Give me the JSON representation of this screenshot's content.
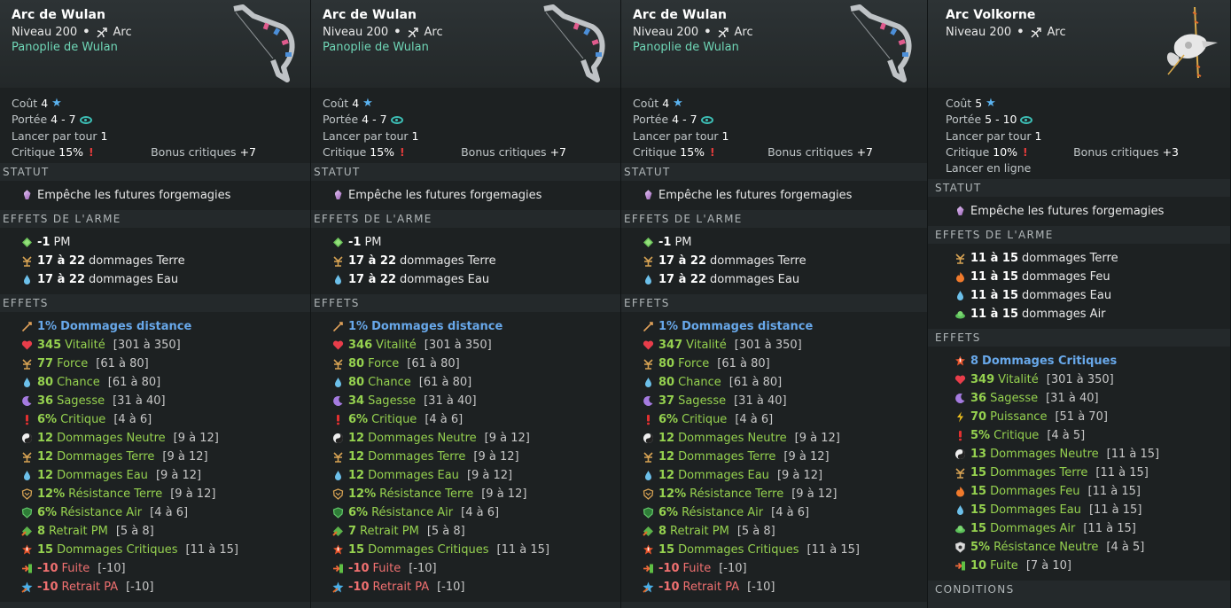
{
  "cards": [
    {
      "name": "Arc de Wulan",
      "level": "Niveau 200",
      "type": "Arc",
      "set": "Panoplie de Wulan",
      "cost_label": "Coût",
      "cost": "4",
      "range_label": "Portée",
      "range": "4 - 7",
      "casts_label": "Lancer par tour",
      "casts": "1",
      "crit_label": "Critique",
      "crit": "15%",
      "crit_bonus_label": "Bonus critiques",
      "crit_bonus": "+7",
      "extra": "",
      "statut_title": "STATUT",
      "statut": "Empêche les futures forgemagies",
      "weapon_effects_title": "EFFETS DE L'ARME",
      "weapon_effects": [
        {
          "icon": "pm-icon",
          "val": "-1",
          "text": "PM"
        },
        {
          "icon": "terre-icon",
          "val": "17 à 22",
          "text": "dommages Terre"
        },
        {
          "icon": "eau-icon",
          "val": "17 à 22",
          "text": "dommages Eau"
        }
      ],
      "effects_title": "EFFETS",
      "effects": [
        {
          "icon": "distance-icon",
          "val": "1%",
          "text": "Dommages distance",
          "range": "",
          "color": "b"
        },
        {
          "icon": "heart-icon",
          "val": "345",
          "text": "Vitalité",
          "range": "[301 à 350]",
          "color": "g"
        },
        {
          "icon": "terre-icon",
          "val": "77",
          "text": "Force",
          "range": "[61 à 80]",
          "color": "g"
        },
        {
          "icon": "eau-icon",
          "val": "80",
          "text": "Chance",
          "range": "[61 à 80]",
          "color": "g"
        },
        {
          "icon": "sagesse-icon",
          "val": "36",
          "text": "Sagesse",
          "range": "[31 à 40]",
          "color": "g"
        },
        {
          "icon": "crit-icon",
          "val": "6%",
          "text": "Critique",
          "range": "[4 à 6]",
          "color": "g"
        },
        {
          "icon": "neutre-icon",
          "val": "12",
          "text": "Dommages Neutre",
          "range": "[9 à 12]",
          "color": "g"
        },
        {
          "icon": "terre-icon",
          "val": "12",
          "text": "Dommages Terre",
          "range": "[9 à 12]",
          "color": "g"
        },
        {
          "icon": "eau-icon",
          "val": "12",
          "text": "Dommages Eau",
          "range": "[9 à 12]",
          "color": "g"
        },
        {
          "icon": "res-terre-icon",
          "val": "12%",
          "text": "Résistance Terre",
          "range": "[9 à 12]",
          "color": "g"
        },
        {
          "icon": "res-air-icon",
          "val": "6%",
          "text": "Résistance Air",
          "range": "[4 à 6]",
          "color": "g"
        },
        {
          "icon": "retrait-pm-icon",
          "val": "8",
          "text": "Retrait PM",
          "range": "[5 à 8]",
          "color": "g"
        },
        {
          "icon": "dommages-crit-icon",
          "val": "15",
          "text": "Dommages Critiques",
          "range": "[11 à 15]",
          "color": "g"
        },
        {
          "icon": "fuite-icon",
          "val": "-10",
          "text": "Fuite",
          "range": "[-10]",
          "color": "r"
        },
        {
          "icon": "retrait-pa-icon",
          "val": "-10",
          "text": "Retrait PA",
          "range": "[-10]",
          "color": "r"
        }
      ]
    },
    {
      "name": "Arc de Wulan",
      "level": "Niveau 200",
      "type": "Arc",
      "set": "Panoplie de Wulan",
      "cost_label": "Coût",
      "cost": "4",
      "range_label": "Portée",
      "range": "4 - 7",
      "casts_label": "Lancer par tour",
      "casts": "1",
      "crit_label": "Critique",
      "crit": "15%",
      "crit_bonus_label": "Bonus critiques",
      "crit_bonus": "+7",
      "extra": "",
      "statut_title": "STATUT",
      "statut": "Empêche les futures forgemagies",
      "weapon_effects_title": "EFFETS DE L'ARME",
      "weapon_effects": [
        {
          "icon": "pm-icon",
          "val": "-1",
          "text": "PM"
        },
        {
          "icon": "terre-icon",
          "val": "17 à 22",
          "text": "dommages Terre"
        },
        {
          "icon": "eau-icon",
          "val": "17 à 22",
          "text": "dommages Eau"
        }
      ],
      "effects_title": "EFFETS",
      "effects": [
        {
          "icon": "distance-icon",
          "val": "1%",
          "text": "Dommages distance",
          "range": "",
          "color": "b"
        },
        {
          "icon": "heart-icon",
          "val": "346",
          "text": "Vitalité",
          "range": "[301 à 350]",
          "color": "g"
        },
        {
          "icon": "terre-icon",
          "val": "80",
          "text": "Force",
          "range": "[61 à 80]",
          "color": "g"
        },
        {
          "icon": "eau-icon",
          "val": "80",
          "text": "Chance",
          "range": "[61 à 80]",
          "color": "g"
        },
        {
          "icon": "sagesse-icon",
          "val": "34",
          "text": "Sagesse",
          "range": "[31 à 40]",
          "color": "g"
        },
        {
          "icon": "crit-icon",
          "val": "6%",
          "text": "Critique",
          "range": "[4 à 6]",
          "color": "g"
        },
        {
          "icon": "neutre-icon",
          "val": "12",
          "text": "Dommages Neutre",
          "range": "[9 à 12]",
          "color": "g"
        },
        {
          "icon": "terre-icon",
          "val": "12",
          "text": "Dommages Terre",
          "range": "[9 à 12]",
          "color": "g"
        },
        {
          "icon": "eau-icon",
          "val": "12",
          "text": "Dommages Eau",
          "range": "[9 à 12]",
          "color": "g"
        },
        {
          "icon": "res-terre-icon",
          "val": "12%",
          "text": "Résistance Terre",
          "range": "[9 à 12]",
          "color": "g"
        },
        {
          "icon": "res-air-icon",
          "val": "6%",
          "text": "Résistance Air",
          "range": "[4 à 6]",
          "color": "g"
        },
        {
          "icon": "retrait-pm-icon",
          "val": "7",
          "text": "Retrait PM",
          "range": "[5 à 8]",
          "color": "g"
        },
        {
          "icon": "dommages-crit-icon",
          "val": "15",
          "text": "Dommages Critiques",
          "range": "[11 à 15]",
          "color": "g"
        },
        {
          "icon": "fuite-icon",
          "val": "-10",
          "text": "Fuite",
          "range": "[-10]",
          "color": "r"
        },
        {
          "icon": "retrait-pa-icon",
          "val": "-10",
          "text": "Retrait PA",
          "range": "[-10]",
          "color": "r"
        }
      ]
    },
    {
      "name": "Arc de Wulan",
      "level": "Niveau 200",
      "type": "Arc",
      "set": "Panoplie de Wulan",
      "cost_label": "Coût",
      "cost": "4",
      "range_label": "Portée",
      "range": "4 - 7",
      "casts_label": "Lancer par tour",
      "casts": "1",
      "crit_label": "Critique",
      "crit": "15%",
      "crit_bonus_label": "Bonus critiques",
      "crit_bonus": "+7",
      "extra": "",
      "statut_title": "STATUT",
      "statut": "Empêche les futures forgemagies",
      "weapon_effects_title": "EFFETS DE L'ARME",
      "weapon_effects": [
        {
          "icon": "pm-icon",
          "val": "-1",
          "text": "PM"
        },
        {
          "icon": "terre-icon",
          "val": "17 à 22",
          "text": "dommages Terre"
        },
        {
          "icon": "eau-icon",
          "val": "17 à 22",
          "text": "dommages Eau"
        }
      ],
      "effects_title": "EFFETS",
      "effects": [
        {
          "icon": "distance-icon",
          "val": "1%",
          "text": "Dommages distance",
          "range": "",
          "color": "b"
        },
        {
          "icon": "heart-icon",
          "val": "347",
          "text": "Vitalité",
          "range": "[301 à 350]",
          "color": "g"
        },
        {
          "icon": "terre-icon",
          "val": "80",
          "text": "Force",
          "range": "[61 à 80]",
          "color": "g"
        },
        {
          "icon": "eau-icon",
          "val": "80",
          "text": "Chance",
          "range": "[61 à 80]",
          "color": "g"
        },
        {
          "icon": "sagesse-icon",
          "val": "37",
          "text": "Sagesse",
          "range": "[31 à 40]",
          "color": "g"
        },
        {
          "icon": "crit-icon",
          "val": "6%",
          "text": "Critique",
          "range": "[4 à 6]",
          "color": "g"
        },
        {
          "icon": "neutre-icon",
          "val": "12",
          "text": "Dommages Neutre",
          "range": "[9 à 12]",
          "color": "g"
        },
        {
          "icon": "terre-icon",
          "val": "12",
          "text": "Dommages Terre",
          "range": "[9 à 12]",
          "color": "g"
        },
        {
          "icon": "eau-icon",
          "val": "12",
          "text": "Dommages Eau",
          "range": "[9 à 12]",
          "color": "g"
        },
        {
          "icon": "res-terre-icon",
          "val": "12%",
          "text": "Résistance Terre",
          "range": "[9 à 12]",
          "color": "g"
        },
        {
          "icon": "res-air-icon",
          "val": "6%",
          "text": "Résistance Air",
          "range": "[4 à 6]",
          "color": "g"
        },
        {
          "icon": "retrait-pm-icon",
          "val": "8",
          "text": "Retrait PM",
          "range": "[5 à 8]",
          "color": "g"
        },
        {
          "icon": "dommages-crit-icon",
          "val": "15",
          "text": "Dommages Critiques",
          "range": "[11 à 15]",
          "color": "g"
        },
        {
          "icon": "fuite-icon",
          "val": "-10",
          "text": "Fuite",
          "range": "[-10]",
          "color": "r"
        },
        {
          "icon": "retrait-pa-icon",
          "val": "-10",
          "text": "Retrait PA",
          "range": "[-10]",
          "color": "r"
        }
      ]
    },
    {
      "name": "Arc Volkorne",
      "level": "Niveau 200",
      "type": "Arc",
      "set": "",
      "cost_label": "Coût",
      "cost": "5",
      "range_label": "Portée",
      "range": "5 - 10",
      "casts_label": "Lancer par tour",
      "casts": "1",
      "crit_label": "Critique",
      "crit": "10%",
      "crit_bonus_label": "Bonus critiques",
      "crit_bonus": "+3",
      "extra": "Lancer en ligne",
      "statut_title": "STATUT",
      "statut": "Empêche les futures forgemagies",
      "weapon_effects_title": "EFFETS DE L'ARME",
      "weapon_effects": [
        {
          "icon": "terre-icon",
          "val": "11 à 15",
          "text": "dommages Terre"
        },
        {
          "icon": "feu-icon",
          "val": "11 à 15",
          "text": "dommages Feu"
        },
        {
          "icon": "eau-icon",
          "val": "11 à 15",
          "text": "dommages Eau"
        },
        {
          "icon": "air-icon",
          "val": "11 à 15",
          "text": "dommages Air"
        }
      ],
      "effects_title": "EFFETS",
      "effects": [
        {
          "icon": "dommages-crit-icon",
          "val": "8",
          "text": "Dommages Critiques",
          "range": "",
          "color": "b"
        },
        {
          "icon": "heart-icon",
          "val": "349",
          "text": "Vitalité",
          "range": "[301 à 350]",
          "color": "g"
        },
        {
          "icon": "sagesse-icon",
          "val": "36",
          "text": "Sagesse",
          "range": "[31 à 40]",
          "color": "g"
        },
        {
          "icon": "puissance-icon",
          "val": "70",
          "text": "Puissance",
          "range": "[51 à 70]",
          "color": "g"
        },
        {
          "icon": "crit-icon",
          "val": "5%",
          "text": "Critique",
          "range": "[4 à 5]",
          "color": "g"
        },
        {
          "icon": "neutre-icon",
          "val": "13",
          "text": "Dommages Neutre",
          "range": "[11 à 15]",
          "color": "g"
        },
        {
          "icon": "terre-icon",
          "val": "15",
          "text": "Dommages Terre",
          "range": "[11 à 15]",
          "color": "g"
        },
        {
          "icon": "feu-icon",
          "val": "15",
          "text": "Dommages Feu",
          "range": "[11 à 15]",
          "color": "g"
        },
        {
          "icon": "eau-icon",
          "val": "15",
          "text": "Dommages Eau",
          "range": "[11 à 15]",
          "color": "g"
        },
        {
          "icon": "air-icon",
          "val": "15",
          "text": "Dommages Air",
          "range": "[11 à 15]",
          "color": "g"
        },
        {
          "icon": "res-neutre-icon",
          "val": "5%",
          "text": "Résistance Neutre",
          "range": "[4 à 5]",
          "color": "g"
        },
        {
          "icon": "fuite-icon",
          "val": "10",
          "text": "Fuite",
          "range": "[7 à 10]",
          "color": "g"
        }
      ],
      "conditions_title": "CONDITIONS"
    }
  ]
}
